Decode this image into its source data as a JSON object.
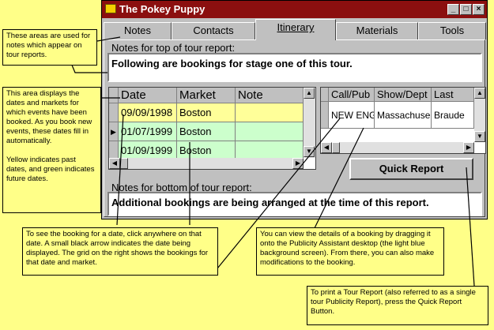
{
  "window": {
    "title": "The Pokey Puppy",
    "controls": {
      "minimize": "_",
      "maximize": "□",
      "close": "×"
    }
  },
  "tabs": [
    "Notes",
    "Contacts",
    "Itinerary",
    "Materials",
    "Tools"
  ],
  "active_tab": "Itinerary",
  "top_notes": {
    "label": "Notes for top of tour report:",
    "value": "Following are bookings for stage one of this tour."
  },
  "dates_grid": {
    "columns": [
      "Date",
      "Market",
      "Note"
    ],
    "rows": [
      {
        "date": "09/09/1998",
        "market": "Boston",
        "note": "",
        "status": "past"
      },
      {
        "date": "01/07/1999",
        "market": "Boston",
        "note": "",
        "status": "future"
      },
      {
        "date": "01/09/1999",
        "market": "Boston",
        "note": "",
        "status": "future"
      }
    ],
    "colors": {
      "past": "#ffff99",
      "future": "#ccffcc"
    }
  },
  "bookings_grid": {
    "columns": [
      "Call/Pub",
      "Show/Dept",
      "Last"
    ],
    "rows": [
      {
        "call_pub": "NEW ENG",
        "show_dept": "Massachuse",
        "last": "Braude"
      }
    ]
  },
  "quick_report_label": "Quick Report",
  "bottom_notes": {
    "label": "Notes for bottom of tour report:",
    "value": "Additional bookings are being arranged at the time of this report."
  },
  "callouts": {
    "notes_areas": "These areas are used for notes which appear on tour reports.",
    "dates_area": "This area displays the dates and markets for which events have been booked. As you book new events, these dates fill in automatically.",
    "colors_area": "Yellow indicates past dates, and green indicates future dates.",
    "see_booking": "To see the booking for a date, click anywhere on that date.  A small black arrow indicates the date being displayed.  The grid on the right shows the bookings for that date and market.",
    "view_details": "You can view the details of a booking by dragging it onto the Publicity Assistant desktop (the light blue background screen).  From there, you can also make modifications to the booking.",
    "print_report": "To print a Tour Report (also referred to as a single tour Publicity Report), press the Quick Report Button."
  },
  "accent_colors": {
    "title_bar": "#8b0f0f",
    "background": "#ffff88"
  }
}
